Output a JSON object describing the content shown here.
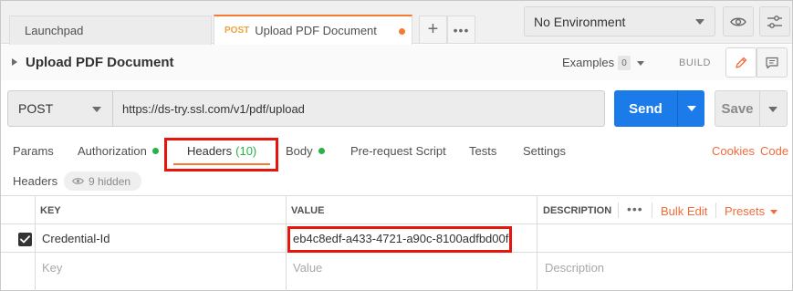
{
  "tabs": {
    "launchpad_label": "Launchpad",
    "active_method": "POST",
    "active_title": "Upload PDF Document",
    "new_tab_glyph": "+",
    "more_glyph": "•••"
  },
  "environment": {
    "selected": "No Environment"
  },
  "request": {
    "title": "Upload PDF Document",
    "examples_label": "Examples",
    "examples_count": "0",
    "build_label": "BUILD",
    "method": "POST",
    "url": "https://ds-try.ssl.com/v1/pdf/upload",
    "send_label": "Send",
    "save_label": "Save"
  },
  "request_tabs": {
    "params": "Params",
    "authorization": "Authorization",
    "headers": "Headers",
    "headers_count": "(10)",
    "body": "Body",
    "pre_request": "Pre-request Script",
    "tests": "Tests",
    "settings": "Settings",
    "cookies": "Cookies",
    "code": "Code"
  },
  "headers_panel": {
    "label": "Headers",
    "hidden_text": "9 hidden",
    "columns": {
      "key": "KEY",
      "value": "VALUE",
      "description": "DESCRIPTION"
    },
    "more_glyph": "•••",
    "bulk_edit": "Bulk Edit",
    "presets": "Presets",
    "rows": [
      {
        "checked": true,
        "key": "Credential-Id",
        "value": "eb4c8edf-a433-4721-a90c-8100adfbd00f",
        "description": ""
      }
    ],
    "placeholders": {
      "key": "Key",
      "value": "Value",
      "description": "Description"
    }
  },
  "colors": {
    "accent": "#f47b32",
    "link": "#f26b3a",
    "send_blue": "#1b7be8",
    "status_green": "#26b247",
    "highlight_red": "#e8150c"
  }
}
